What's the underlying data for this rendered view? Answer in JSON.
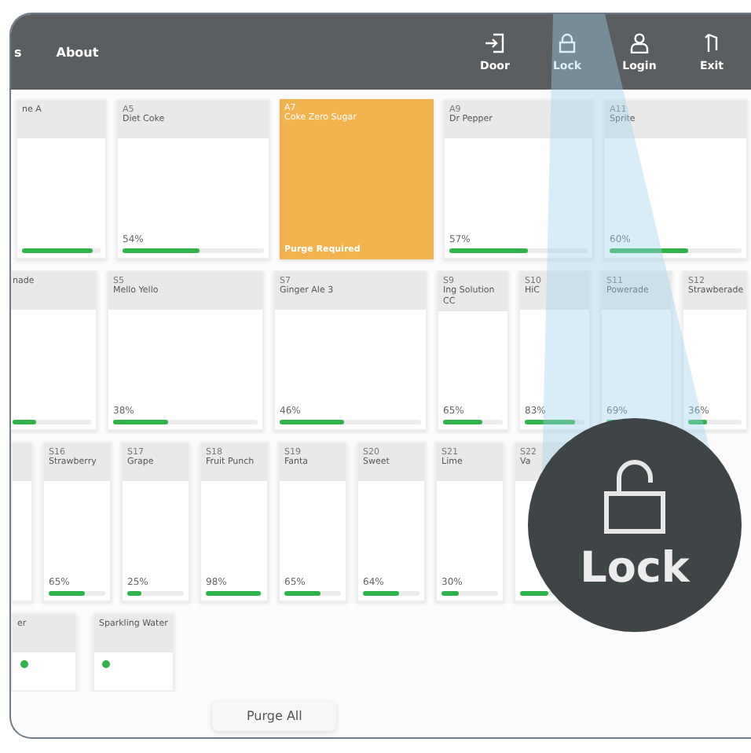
{
  "nav": {
    "tabs": [
      {
        "label": "s"
      },
      {
        "label": "About"
      }
    ],
    "actions": [
      {
        "label": "Door",
        "kind": "door"
      },
      {
        "label": "Lock",
        "kind": "lock"
      },
      {
        "label": "Login",
        "kind": "login"
      },
      {
        "label": "Exit",
        "kind": "exit"
      }
    ]
  },
  "rows": [
    {
      "tiles": [
        {
          "name": "ne A",
          "level": 0.9,
          "kind": "normal"
        },
        {
          "code": "A5",
          "name": "Diet Coke",
          "percent": "54%",
          "level": 0.54,
          "kind": "normal"
        },
        {
          "code": "A7",
          "name": "Coke Zero Sugar",
          "status": "Purge Required",
          "kind": "alert"
        },
        {
          "code": "A9",
          "name": "Dr Pepper",
          "percent": "57%",
          "level": 0.57,
          "kind": "normal"
        },
        {
          "code": "A11",
          "name": "Sprite",
          "percent": "60%",
          "level": 0.6,
          "kind": "normal"
        }
      ]
    },
    {
      "tiles": [
        {
          "name": "nade",
          "level": 0.3,
          "kind": "normal"
        },
        {
          "code": "S5",
          "name": "Mello Yello",
          "percent": "38%",
          "level": 0.38,
          "kind": "normal"
        },
        {
          "code": "S7",
          "name": "Ginger Ale 3",
          "percent": "46%",
          "level": 0.46,
          "kind": "normal"
        },
        {
          "code": "S9",
          "name": "Ing Solution CC",
          "percent": "65%",
          "level": 0.65,
          "kind": "normal"
        },
        {
          "code": "S10",
          "name": "HiC",
          "percent": "83%",
          "level": 0.83,
          "kind": "normal"
        },
        {
          "code": "S11",
          "name": "Powerade",
          "percent": "69%",
          "level": 0.69,
          "kind": "normal"
        },
        {
          "code": "S12",
          "name": "Strawberade",
          "percent": "36%",
          "level": 0.36,
          "kind": "normal"
        }
      ]
    },
    {
      "tiles": [
        {
          "kind": "empty"
        },
        {
          "code": "S16",
          "name": "Strawberry",
          "percent": "65%",
          "level": 0.65,
          "kind": "normal"
        },
        {
          "code": "S17",
          "name": "Grape",
          "percent": "25%",
          "level": 0.25,
          "kind": "normal"
        },
        {
          "code": "S18",
          "name": "Fruit Punch",
          "percent": "98%",
          "level": 0.98,
          "kind": "normal"
        },
        {
          "code": "S19",
          "name": "Fanta",
          "percent": "65%",
          "level": 0.65,
          "kind": "normal"
        },
        {
          "code": "S20",
          "name": "Sweet",
          "percent": "64%",
          "level": 0.64,
          "kind": "normal"
        },
        {
          "code": "S21",
          "name": "Lime",
          "percent": "30%",
          "level": 0.3,
          "kind": "normal"
        },
        {
          "code": "S22",
          "name": "Va",
          "level": 0.5,
          "kind": "normal"
        }
      ]
    },
    {
      "tiles": [
        {
          "name": "er",
          "kind": "dot"
        },
        {
          "name": "Sparkling Water",
          "kind": "dot"
        }
      ]
    }
  ],
  "purge_button": "Purge All",
  "callout": {
    "label": "Lock"
  }
}
